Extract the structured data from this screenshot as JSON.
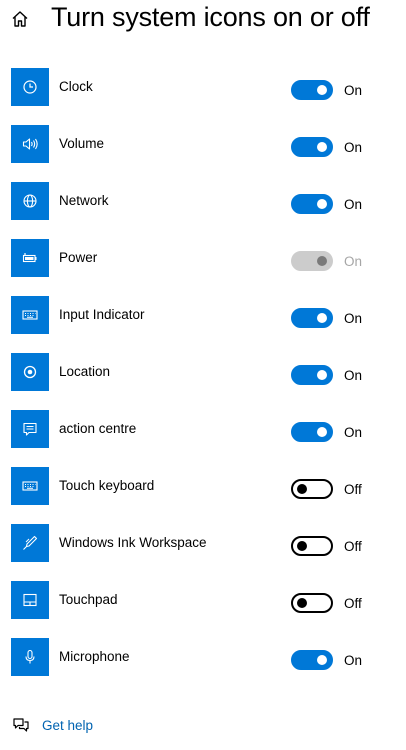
{
  "header": {
    "title": "Turn system icons on or off",
    "home_icon": "home-icon"
  },
  "colors": {
    "accent": "#0078d7",
    "link": "#0063b1",
    "disabled_toggle": "#cccccc",
    "disabled_text": "#a6a6a6"
  },
  "settings": [
    {
      "label": "Clock",
      "icon": "clock-icon",
      "state": "on",
      "state_label": "On"
    },
    {
      "label": "Volume",
      "icon": "volume-icon",
      "state": "on",
      "state_label": "On"
    },
    {
      "label": "Network",
      "icon": "network-icon",
      "state": "on",
      "state_label": "On"
    },
    {
      "label": "Power",
      "icon": "battery-icon",
      "state": "disabled",
      "state_label": "On"
    },
    {
      "label": "Input Indicator",
      "icon": "keyboard-icon",
      "state": "on",
      "state_label": "On"
    },
    {
      "label": "Location",
      "icon": "location-icon",
      "state": "on",
      "state_label": "On"
    },
    {
      "label": "action centre",
      "icon": "action-centre-icon",
      "state": "on",
      "state_label": "On"
    },
    {
      "label": "Touch keyboard",
      "icon": "touch-keyboard-icon",
      "state": "off",
      "state_label": "Off"
    },
    {
      "label": "Windows Ink Workspace",
      "icon": "pen-icon",
      "state": "off",
      "state_label": "Off"
    },
    {
      "label": "Touchpad",
      "icon": "touchpad-icon",
      "state": "off",
      "state_label": "Off"
    },
    {
      "label": "Microphone",
      "icon": "microphone-icon",
      "state": "on",
      "state_label": "On"
    }
  ],
  "help": {
    "label": "Get help",
    "icon": "help-chat-icon"
  }
}
